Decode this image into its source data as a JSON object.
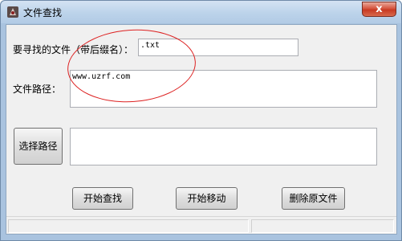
{
  "window": {
    "title": "文件查找",
    "close_glyph": "x"
  },
  "form": {
    "file_name_label": "要寻找的文件（带后缀名）：",
    "file_name_value": ".txt",
    "path_label": "文件路径：",
    "path_value": "www.uzrf.com",
    "choose_path_button": "选择路径",
    "selected_path_value": ""
  },
  "actions": {
    "start_search": "开始查找",
    "start_move": "开始移动",
    "delete_original": "删除原文件"
  },
  "annotation": {
    "color": "#dd2222"
  },
  "icons": [
    "app-icon",
    "close-icon"
  ]
}
